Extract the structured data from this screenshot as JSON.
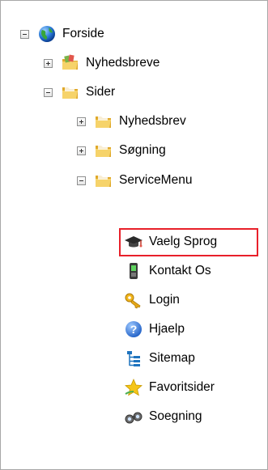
{
  "tree": {
    "root": {
      "label": "Forside",
      "icon": "globe-icon",
      "toggle": "collapse"
    },
    "nyhedsbreve": {
      "label": "Nyhedsbreve",
      "icon": "folder-icon",
      "toggle": "expand"
    },
    "sider": {
      "label": "Sider",
      "icon": "folder-icon",
      "toggle": "collapse"
    },
    "nyhedsbrev": {
      "label": "Nyhedsbrev",
      "icon": "folder-icon",
      "toggle": "expand"
    },
    "sogning": {
      "label": "Søgning",
      "icon": "folder-icon",
      "toggle": "expand"
    },
    "servicemenu": {
      "label": "ServiceMenu",
      "icon": "folder-icon",
      "toggle": "collapse"
    },
    "leaves": [
      {
        "label": "Vaelg Sprog",
        "icon": "graduation-cap-icon",
        "selected": true
      },
      {
        "label": "Kontakt Os",
        "icon": "mobile-phone-icon"
      },
      {
        "label": "Login",
        "icon": "key-icon"
      },
      {
        "label": "Hjaelp",
        "icon": "help-icon"
      },
      {
        "label": "Sitemap",
        "icon": "sitemap-icon"
      },
      {
        "label": "Favoritsider",
        "icon": "star-icon"
      },
      {
        "label": "Soegning",
        "icon": "binoculars-icon"
      }
    ]
  },
  "colors": {
    "selection_border": "#e8202a",
    "folder": "#f2c94c",
    "frame_border": "#a7a7a7"
  }
}
